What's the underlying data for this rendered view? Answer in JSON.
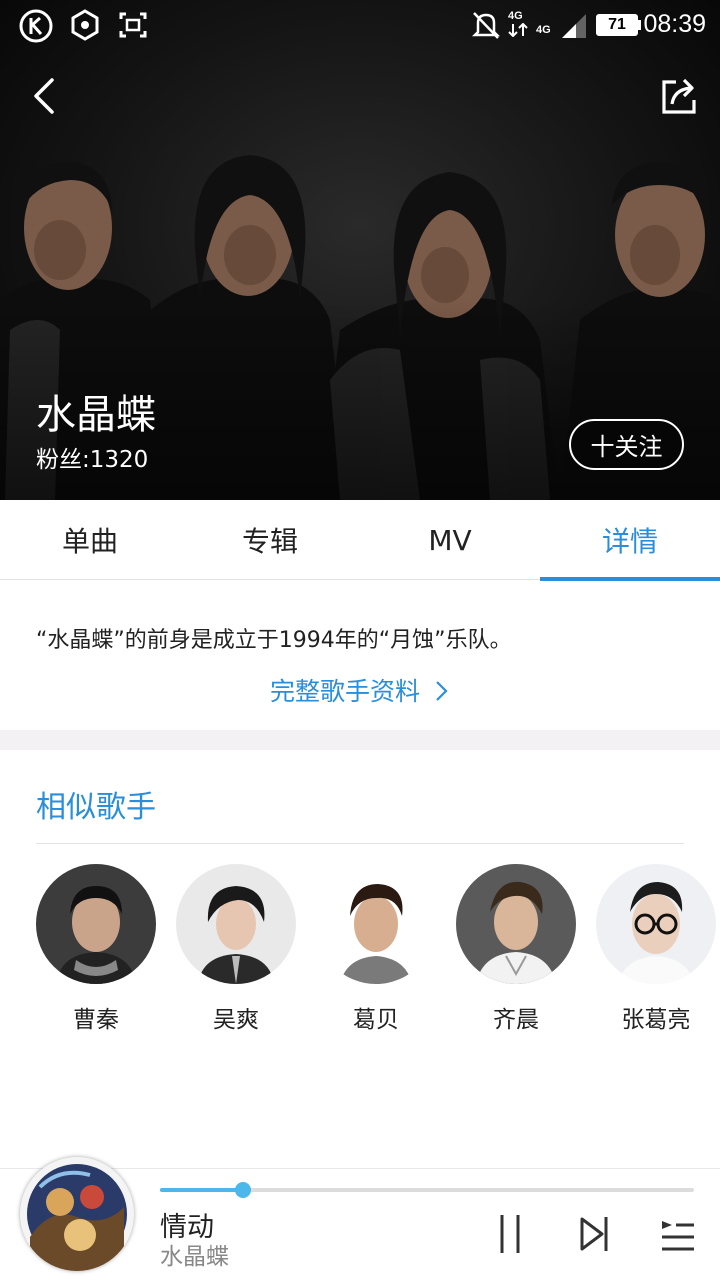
{
  "status_bar": {
    "time": "08:39",
    "battery": "71",
    "network_label": "4G",
    "network_label_2": "4G",
    "icons": [
      "k-app-icon",
      "hexagon-app-icon",
      "screenshot-icon",
      "mute-bell-icon",
      "data-arrows-icon",
      "signal-icon",
      "battery-icon"
    ]
  },
  "header": {
    "back_icon": "chevron-left-icon",
    "share_icon": "share-icon"
  },
  "artist": {
    "name": "水晶蝶",
    "fans": "粉丝:1320",
    "follow_label": "十关注"
  },
  "tabs": [
    {
      "label": "单曲",
      "active": false
    },
    {
      "label": "专辑",
      "active": false
    },
    {
      "label": "MV",
      "active": false
    },
    {
      "label": "详情",
      "active": true
    }
  ],
  "detail": {
    "intro": "“水晶蝶”的前身是成立于1994年的“月蚀”乐队。",
    "full_profile_link": "完整歌手资料"
  },
  "similar": {
    "title": "相似歌手",
    "singers": [
      {
        "name": "曹秦"
      },
      {
        "name": "吴爽"
      },
      {
        "name": "葛贝"
      },
      {
        "name": "齐晨"
      },
      {
        "name": "张葛亮"
      }
    ]
  },
  "player": {
    "song": "情动",
    "artist": "水晶蝶",
    "progress": 0.155,
    "controls": [
      "pause-icon",
      "next-icon",
      "playlist-icon"
    ]
  },
  "colors": {
    "accent": "#2a8ed8",
    "progress": "#4bb7ea"
  }
}
